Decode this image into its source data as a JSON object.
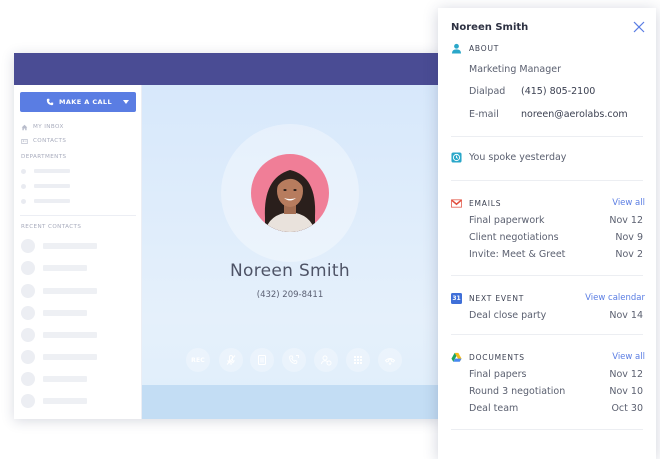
{
  "sidebar": {
    "call_button": "MAKE A CALL",
    "nav": [
      {
        "label": "MY INBOX",
        "icon": "home-icon"
      },
      {
        "label": "CONTACTS",
        "icon": "contacts-icon"
      }
    ],
    "departments_label": "DEPARTMENTS",
    "recent_label": "RECENT CONTACTS"
  },
  "call": {
    "name": "Noreen Smith",
    "phone": "(432) 209-8411",
    "rec_label": "REC",
    "controls": [
      "rec-button",
      "mute-icon",
      "hold-icon",
      "transfer-icon",
      "add-person-icon",
      "keypad-icon",
      "hangup-icon"
    ]
  },
  "panel": {
    "title": "Noreen Smith",
    "about": {
      "label": "ABOUT",
      "job_title": "Marketing Manager",
      "dialpad_label": "Dialpad",
      "dialpad_value": "(415) 805-2100",
      "email_label": "E-mail",
      "email_value": "noreen@aerolabs.com"
    },
    "spoke": "You spoke yesterday",
    "emails": {
      "label": "EMAILS",
      "action": "View all",
      "items": [
        {
          "title": "Final paperwork",
          "date": "Nov 12"
        },
        {
          "title": "Client negotiations",
          "date": "Nov 9"
        },
        {
          "title": "Invite: Meet & Greet",
          "date": "Nov 2"
        }
      ]
    },
    "next_event": {
      "label": "NEXT EVENT",
      "icon_text": "31",
      "action": "View calendar",
      "items": [
        {
          "title": "Deal close party",
          "date": "Nov 14"
        }
      ]
    },
    "documents": {
      "label": "DOCUMENTS",
      "action": "View all",
      "items": [
        {
          "title": "Final papers",
          "date": "Nov 12"
        },
        {
          "title": "Round 3 negotiation",
          "date": "Nov 10"
        },
        {
          "title": "Deal team",
          "date": "Oct 30"
        }
      ]
    }
  },
  "colors": {
    "topbar": "#4a4c94",
    "accent": "#5a7de3",
    "avatar_ring": "#f07e97",
    "main_bg": "#d7e8fb"
  }
}
